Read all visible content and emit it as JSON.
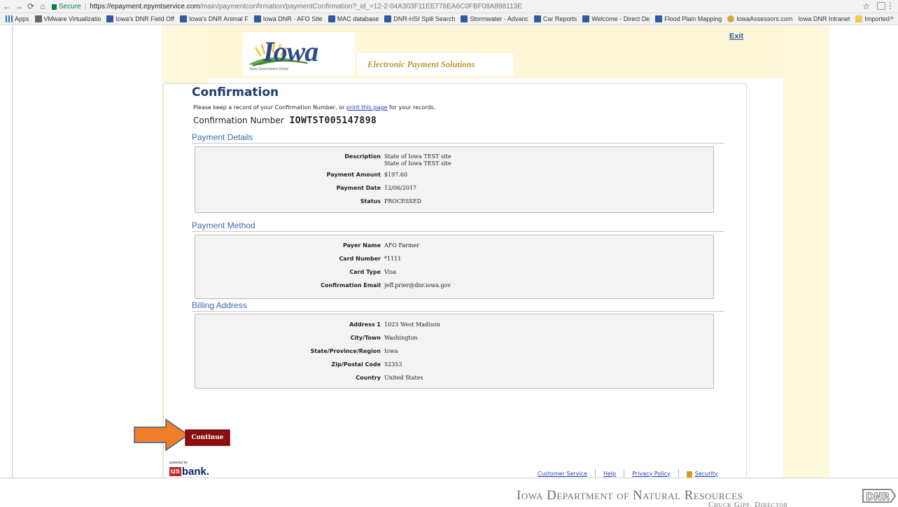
{
  "browser": {
    "secure_label": "Secure",
    "url_host": "https://epayment.epymtservice.com",
    "url_path": "/main/paymentconfirmation/paymentConfirmation?_id_=12-2-04A303F11EE778EA6C0FBF08A898113E",
    "bookmarks": [
      {
        "label": "Apps",
        "icon": "apps-grid-icon"
      },
      {
        "label": "VMware Virtualizatio",
        "icon": "vmware-icon"
      },
      {
        "label": "Iowa's DNR Field Off",
        "icon": "dnr-bookmark-icon"
      },
      {
        "label": "Iowa's DNR Animal F",
        "icon": "dnr-bookmark-icon"
      },
      {
        "label": "Iowa DNR - AFO Site",
        "icon": "dnr-bookmark-icon"
      },
      {
        "label": "MAC database",
        "icon": "dnr-bookmark-icon"
      },
      {
        "label": "DNR-HSI Spill Search",
        "icon": "dnr-bookmark-icon"
      },
      {
        "label": "Stormwater - Advanc",
        "icon": "dnr-bookmark-icon"
      },
      {
        "label": "Car Reports",
        "icon": "dnr-bookmark-icon"
      },
      {
        "label": "Welcome - Direct De",
        "icon": "dnr-bookmark-icon"
      },
      {
        "label": "Flood Plain Mapping",
        "icon": "dnr-bookmark-icon"
      },
      {
        "label": "IowaAssessors.com",
        "icon": "globe-icon"
      },
      {
        "label": "Iowa DNR Intranet",
        "icon": "page-icon"
      },
      {
        "label": "Imported",
        "icon": "folder-icon"
      }
    ],
    "more": "»"
  },
  "header": {
    "logo_text": "Iowa",
    "logo_subtext": "Iowa Government Online",
    "tagline": "Electronic Payment Solutions",
    "exit_label": "Exit"
  },
  "confirmation": {
    "title": "Confirmation",
    "keep_before": "Please keep a record of your Confirmation Number, or ",
    "print_link": "print this page",
    "keep_after": " for your records.",
    "number_label": "Confirmation Number",
    "number_value": "IOWTST005147898"
  },
  "payment_details": {
    "title": "Payment Details",
    "description_label": "Description",
    "description_line1": "State of Iowa TEST site",
    "description_line2": "State of Iowa TEST site",
    "amount_label": "Payment Amount",
    "amount_value": "$197.60",
    "date_label": "Payment Date",
    "date_value": "12/06/2017",
    "status_label": "Status",
    "status_value": "PROCESSED"
  },
  "payment_method": {
    "title": "Payment Method",
    "payer_label": "Payer Name",
    "payer_value": "AFO Farmer",
    "card_number_label": "Card Number",
    "card_number_value": "*1111",
    "card_type_label": "Card Type",
    "card_type_value": "Visa",
    "email_label": "Confirmation Email",
    "email_value": "jeff.prier@dnr.iowa.gov"
  },
  "billing_address": {
    "title": "Billing Address",
    "address1_label": "Address 1",
    "address1_value": "1023 West Madison",
    "city_label": "City/Town",
    "city_value": "Washington",
    "state_label": "State/Province/Region",
    "state_value": "Iowa",
    "zip_label": "Zip/Postal Code",
    "zip_value": "52353",
    "country_label": "Country",
    "country_value": "United States"
  },
  "actions": {
    "continue_label": "Continue"
  },
  "footer": {
    "powered_by": "powered by",
    "bank_us": "us",
    "bank_word": "bank.",
    "customer_service": "Customer Service",
    "help": "Help",
    "privacy_policy": "Privacy Policy",
    "security": "Security"
  },
  "slide": {
    "org_name": "Iowa Department of Natural Resources",
    "director": "Chuck Gipp, Director",
    "logo_text": "DNR"
  },
  "colors": {
    "title_navy": "#1f3a6e",
    "section_blue": "#3a6aa8",
    "continue_red": "#8b0e12",
    "arrow_orange": "#ef7d2a",
    "header_beige": "#fdf6d8"
  }
}
